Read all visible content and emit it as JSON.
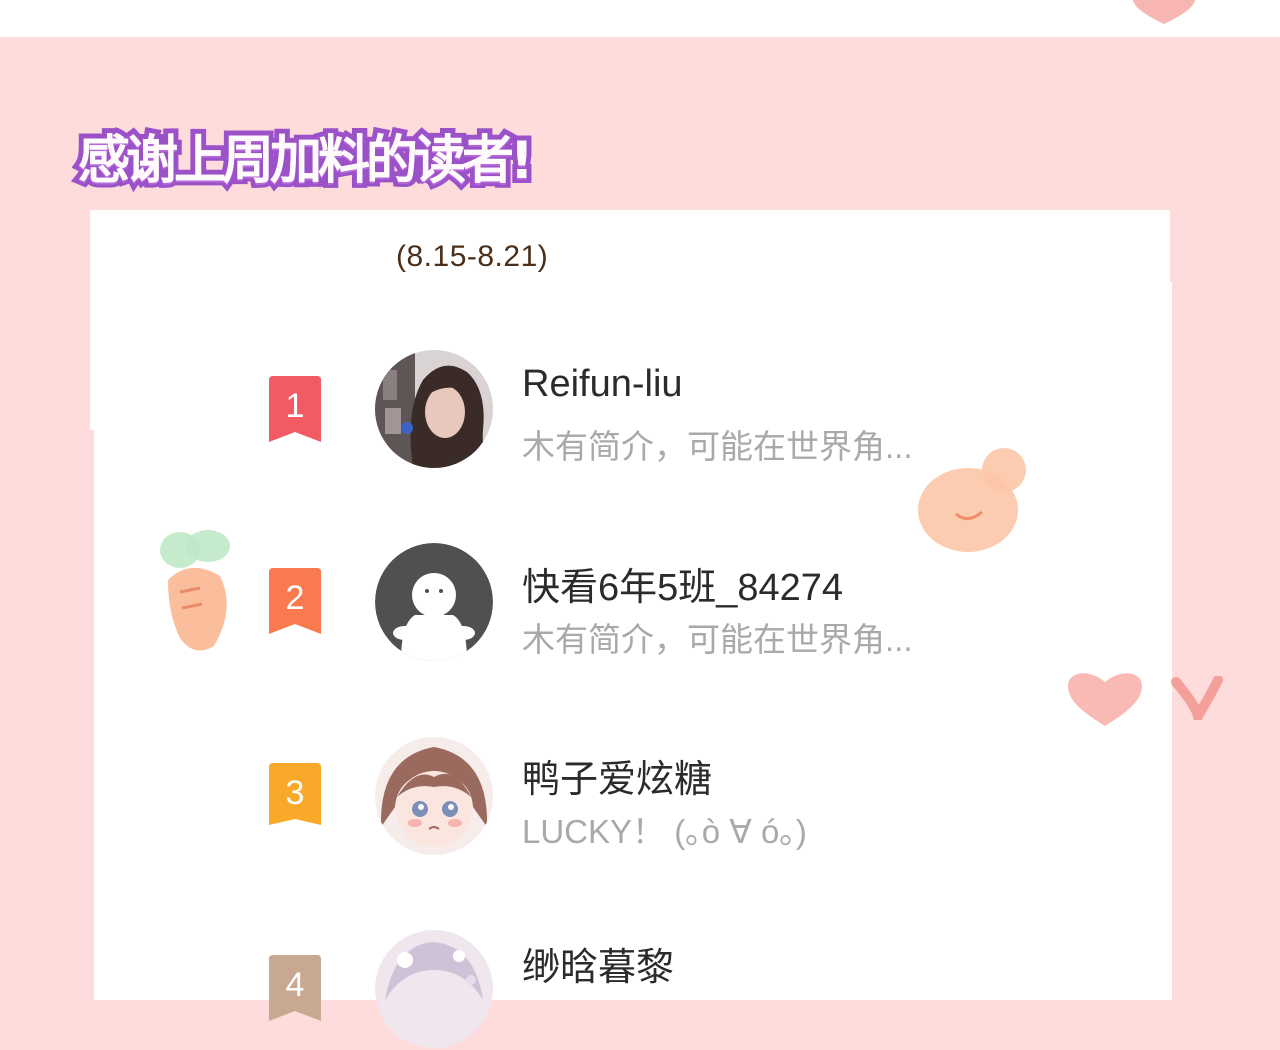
{
  "header": {
    "title": "感谢上周加料的读者!"
  },
  "period": {
    "label": "(8.15-8.21)"
  },
  "rankings": [
    {
      "rank": "1",
      "name": "Reifun-liu",
      "bio": "木有简介，可能在世界角...",
      "badge_color": "#f25b63",
      "avatar": "photo-portrait-avatar"
    },
    {
      "rank": "2",
      "name": "快看6年5班_84274",
      "bio": "木有简介，可能在世界角...",
      "badge_color": "#f97a4e",
      "avatar": "default-ghost-avatar"
    },
    {
      "rank": "3",
      "name": "鸭子爱炫糖",
      "bio": "LUCKY！ (｡ò ∀ ó｡)",
      "badge_color": "#f8a92a",
      "avatar": "anime-girl-avatar"
    },
    {
      "rank": "4",
      "name": "缈晗暮黎",
      "bio": "",
      "badge_color": "#c8a890",
      "avatar": "anime-boy-avatar"
    }
  ],
  "colors": {
    "background": "#ffdcdc",
    "card": "#ffffff",
    "title_stroke": "#9b52c9",
    "name_text": "#2b2b2b",
    "bio_text": "#a9a9a9",
    "date_text": "#4a2f1a"
  },
  "decorations": [
    "heart-sticker",
    "bear-sticker",
    "carrot-sticker",
    "small-heart-sticker"
  ]
}
